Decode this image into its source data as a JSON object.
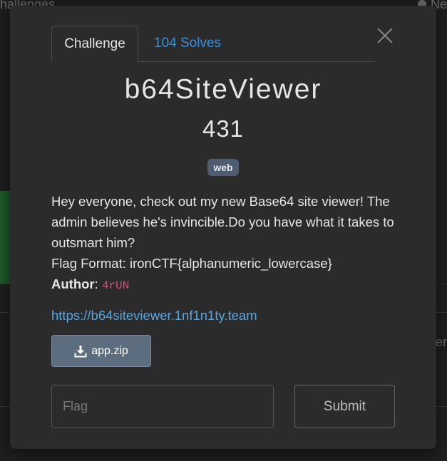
{
  "background": {
    "title_fragment": "hallenges",
    "new_fragment": "Ne",
    "right_fragment": "er"
  },
  "tabs": [
    {
      "label": "Challenge",
      "active": true
    },
    {
      "label": "104 Solves",
      "active": false
    }
  ],
  "challenge": {
    "name": "b64SiteViewer",
    "points": "431",
    "tag": "web",
    "description_line1": "Hey everyone, check out my new Base64 site viewer! The admin believes he's invincible.Do you have what it takes to outsmart him?",
    "flag_format": "Flag Format: ironCTF{alphanumeric_lowercase}",
    "author_label": "Author",
    "author_sep": ": ",
    "author_name": "4rUN",
    "link": "https://b64siteviewer.1nf1n1ty.team",
    "file_label": "app.zip"
  },
  "form": {
    "flag_placeholder": "Flag",
    "submit_label": "Submit"
  },
  "icons": {
    "close": "close-icon",
    "download": "download-icon",
    "bell": "bell-icon"
  },
  "colors": {
    "modal_bg": "#2b2b2b",
    "link": "#58a6e0",
    "tab_link": "#3d8fd6",
    "author": "#e0457b",
    "tag_bg": "#4e5d72",
    "file_button": "#5d6d80"
  }
}
